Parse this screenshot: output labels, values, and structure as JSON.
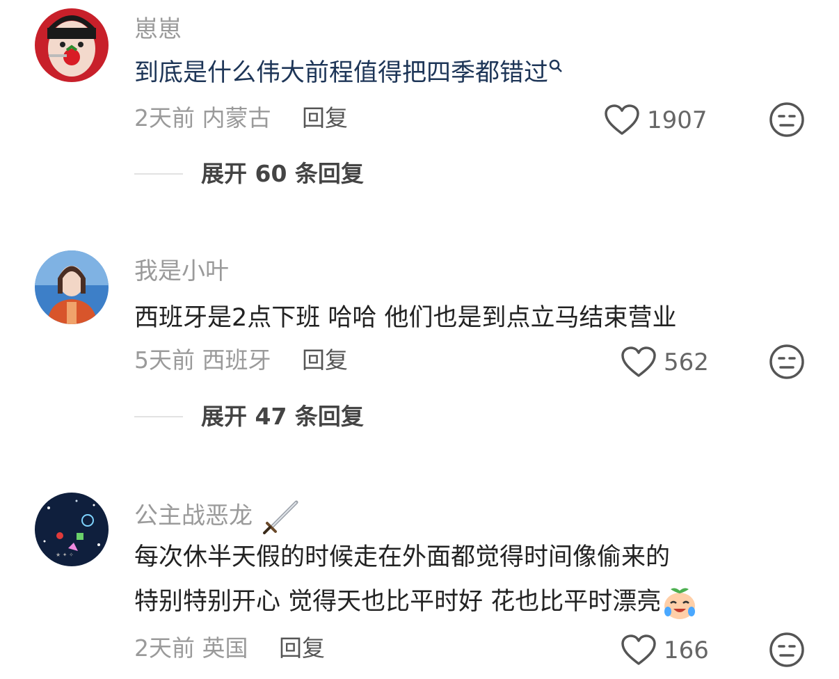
{
  "comments": [
    {
      "username": "崽崽",
      "text": "到底是什么伟大前程值得把四季都错过",
      "search_marker": "⌕",
      "time": "2天前",
      "location": "内蒙古",
      "reply_label": "回复",
      "likes": "1907",
      "expand_label": "展开 60 条回复",
      "avatar_icon": "avatar-girl-strawberry",
      "colors": {
        "avatar_bg": "#c8202a"
      }
    },
    {
      "username": "我是小叶",
      "text": "西班牙是2点下班 哈哈 他们也是到点立马结束营业",
      "time": "5天前",
      "location": "西班牙",
      "reply_label": "回复",
      "likes": "562",
      "expand_label": "展开 47 条回复",
      "avatar_icon": "avatar-girl-blue-sky",
      "colors": {
        "avatar_bg": "#3d7fc8"
      }
    },
    {
      "username": "公主战恶龙",
      "username_icon": "sword-icon",
      "text_line1": "每次休半天假的时候走在外面都觉得时间像偷来的",
      "text_line2": "特别特别开心 觉得天也比平时好 花也比平时漂亮",
      "text_emoji": "crying-laughing-peach-emoji",
      "time": "2天前",
      "location": "英国",
      "reply_label": "回复",
      "likes": "166",
      "avatar_icon": "avatar-night-sky-stickers",
      "colors": {
        "avatar_bg": "#0f1f3d"
      }
    }
  ],
  "icons": {
    "like": "heart-outline-icon",
    "dislike": "meh-face-icon"
  }
}
